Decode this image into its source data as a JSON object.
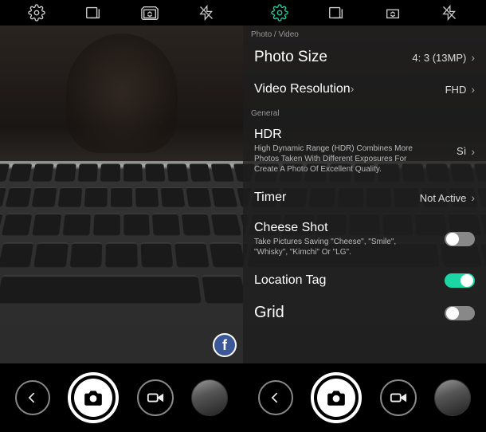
{
  "topbar": {
    "icons": [
      "settings-gear",
      "view-mode",
      "switch-camera",
      "flash-off"
    ]
  },
  "settings": {
    "section_photo_video": "Photo / Video",
    "photo_size": {
      "label": "Photo Size",
      "value": "4: 3 (13MP)"
    },
    "video_res": {
      "label": "Video Resolution",
      "value": "FHD"
    },
    "section_general": "General",
    "hdr": {
      "label": "HDR",
      "desc": "High Dynamic Range (HDR) Combines More Photos Taken With Different Exposures For Create A Photo Of Excellent Quality.",
      "value": "Sì"
    },
    "timer": {
      "label": "Timer",
      "value": "Not Active"
    },
    "cheese": {
      "label": "Cheese Shot",
      "desc": "Take Pictures Saving \"Cheese\", \"Smile\", \"Whisky\", \"Kimchi\" Or \"LG\".",
      "on": false
    },
    "location": {
      "label": "Location Tag",
      "on": true
    },
    "grid": {
      "label": "Grid",
      "on": false
    }
  },
  "social": {
    "fb": "f"
  }
}
